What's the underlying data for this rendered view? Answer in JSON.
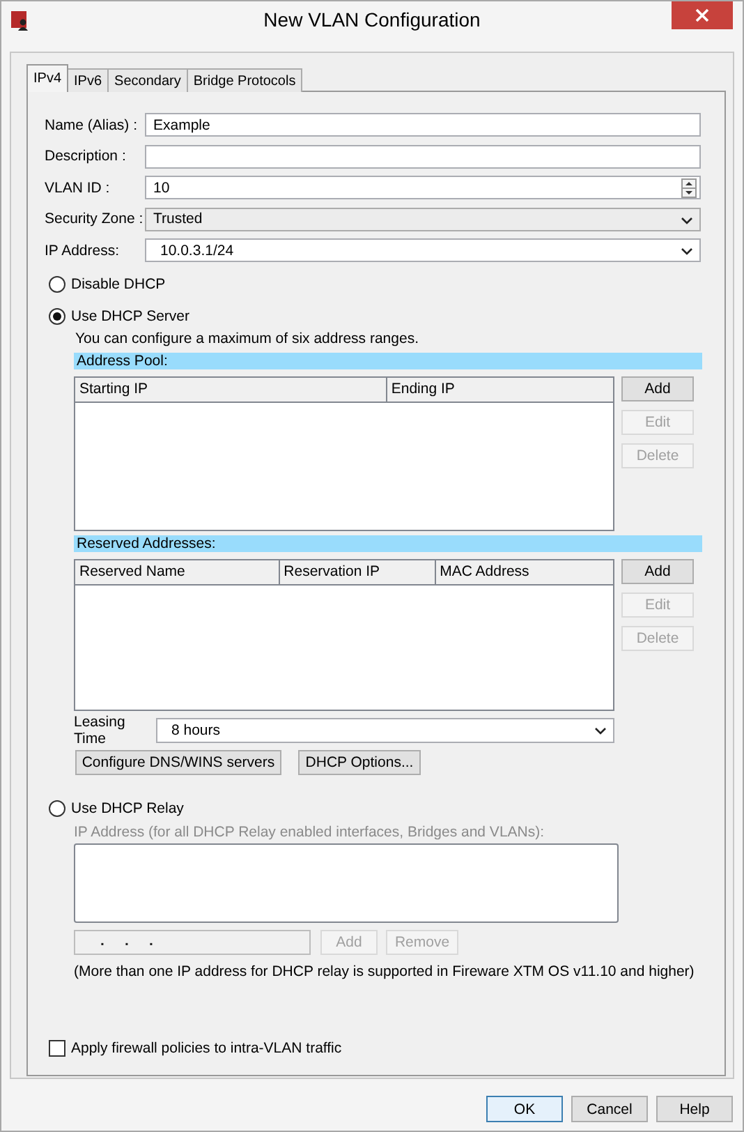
{
  "window": {
    "title": "New VLAN Configuration"
  },
  "tabs": [
    {
      "label": "IPv4",
      "selected": true
    },
    {
      "label": "IPv6",
      "selected": false
    },
    {
      "label": "Secondary",
      "selected": false
    },
    {
      "label": "Bridge Protocols",
      "selected": false
    }
  ],
  "fields": [
    {
      "kind": "text",
      "label": "Name (Alias) :",
      "value": "Example"
    },
    {
      "kind": "text",
      "label": "Description :"
    },
    {
      "kind": "spin",
      "label": "VLAN ID :",
      "value": "10"
    },
    {
      "kind": "dropdown",
      "label": "Security Zone :",
      "value": "Trusted"
    },
    {
      "kind": "combo",
      "label": "IP Address:",
      "value": "10.0.3.1/24"
    }
  ],
  "disable_dhcp": {
    "label": "Disable DHCP",
    "selected": false
  },
  "dhcp_server": {
    "label": "Use DHCP Server",
    "selected": true,
    "note": "You can configure a maximum of six address ranges.",
    "tables": [
      {
        "title": "Address Pool:",
        "columns": [
          "Starting IP",
          "Ending IP"
        ],
        "buttons": [
          {
            "label": "Add",
            "disabled": false
          },
          {
            "label": "Edit",
            "disabled": true
          },
          {
            "label": "Delete",
            "disabled": true
          }
        ]
      },
      {
        "title": "Reserved Addresses:",
        "columns": [
          "Reserved Name",
          "Reservation IP",
          "MAC Address"
        ],
        "buttons": [
          {
            "label": "Add",
            "disabled": false
          },
          {
            "label": "Edit",
            "disabled": true
          },
          {
            "label": "Delete",
            "disabled": true
          }
        ]
      }
    ],
    "leasing": {
      "label": "Leasing Time",
      "value": "8 hours"
    },
    "buttons": [
      "Configure DNS/WINS servers",
      "DHCP Options..."
    ]
  },
  "dhcp_relay": {
    "label": "Use DHCP Relay",
    "selected": false,
    "list_label": {
      "text": "IP Address (for all DHCP Relay enabled interfaces, Bridges and VLANs):",
      "disabled": true
    },
    "ip_entry": {
      "value": ".     .     .",
      "disabled": true
    },
    "buttons": [
      {
        "label": "Add",
        "disabled": true
      },
      {
        "label": "Remove",
        "disabled": true
      }
    ],
    "note": "(More than one IP address for DHCP relay is supported in Fireware XTM OS v11.10 and higher)"
  },
  "intra_vlan": {
    "label": "Apply firewall policies to intra-VLAN traffic",
    "checked": false
  },
  "footer_buttons": [
    {
      "label": "OK",
      "default": true
    },
    {
      "label": "Cancel",
      "default": false
    },
    {
      "label": "Help",
      "default": false
    }
  ]
}
